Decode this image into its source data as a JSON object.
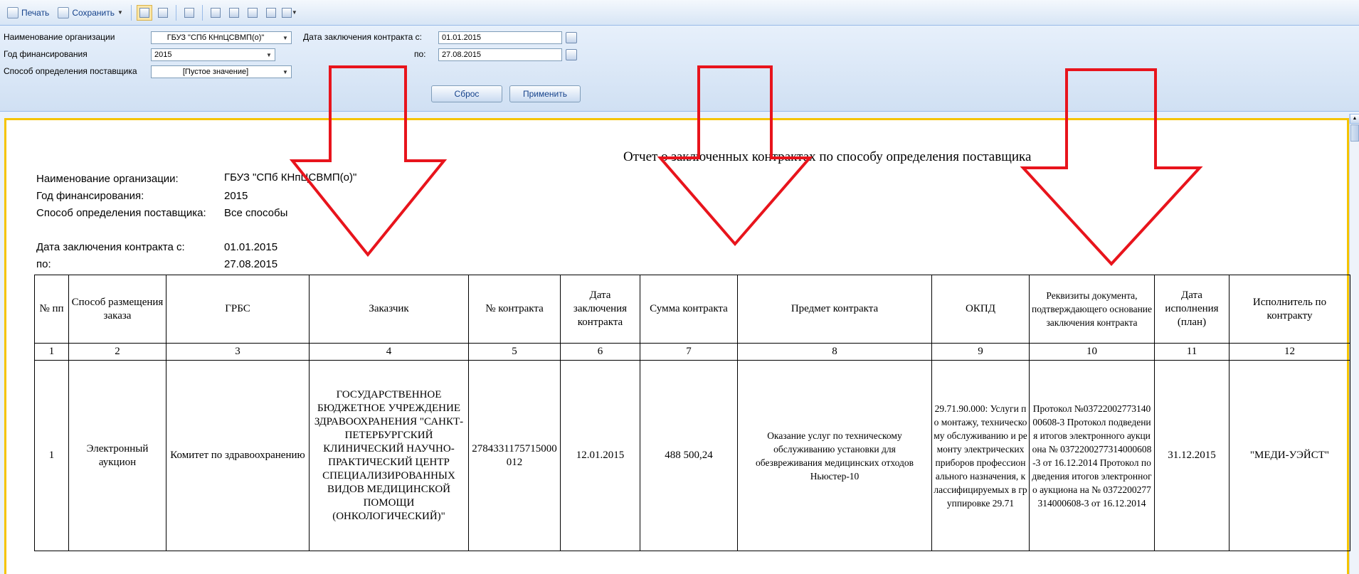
{
  "toolbar": {
    "print_label": "Печать",
    "save_label": "Сохранить"
  },
  "filters": {
    "org_label": "Наименование организации",
    "org_value": "ГБУЗ \"СПб КНпЦСВМП(о)\"",
    "year_label": "Год финансирования",
    "year_value": "2015",
    "method_label": "Способ определения поставщика",
    "method_value": "[Пустое значение]",
    "date_from_label": "Дата заключения контракта с:",
    "date_from_value": "01.01.2015",
    "date_to_label": "по:",
    "date_to_value": "27.08.2015",
    "reset_label": "Сброс",
    "apply_label": "Применить"
  },
  "report": {
    "title": "Отчет о заключенных контрактах по способу определения поставщика",
    "info": [
      {
        "label": "Наименование организации:",
        "value": "ГБУЗ \"СПб КНпЦСВМП(о)\""
      },
      {
        "label": "Год финансирования:",
        "value": "2015"
      },
      {
        "label": "Способ определения поставщика:",
        "value": "Все способы"
      },
      {
        "label": "Дата заключения контракта с:",
        "value": "01.01.2015"
      },
      {
        "label": "по:",
        "value": "27.08.2015"
      }
    ],
    "columns": [
      "№ пп",
      "Способ размещения заказа",
      "ГРБС",
      "Заказчик",
      "№ контракта",
      "Дата заключения контракта",
      "Сумма контракта",
      "Предмет контракта",
      "ОКПД",
      "Реквизиты документа, подтверждающего основание заключения контракта",
      "Дата исполнения (план)",
      "Исполнитель по контракту"
    ],
    "column_numbers": [
      "1",
      "2",
      "3",
      "4",
      "5",
      "6",
      "7",
      "8",
      "9",
      "10",
      "11",
      "12"
    ],
    "rows": [
      {
        "n": "1",
        "method": "Электронный аукцион",
        "grbs": "Комитет по здравоохранению",
        "customer": "ГОСУДАРСТВЕННОЕ БЮДЖЕТНОЕ УЧРЕЖДЕНИЕ ЗДРАВООХРАНЕНИЯ \"САНКТ-ПЕТЕРБУРГСКИЙ КЛИНИЧЕСКИЙ НАУЧНО-ПРАКТИЧЕСКИЙ ЦЕНТР СПЕЦИАЛИЗИРОВАННЫХ ВИДОВ МЕДИЦИНСКОЙ ПОМОЩИ (ОНКОЛОГИЧЕСКИЙ)\"",
        "contract_no": "2784331175715000012",
        "date": "12.01.2015",
        "sum": "488 500,24",
        "subject": "Оказание услуг по техническому обслуживанию установки для обезвреживания медицинских отходов Ньюстер-10",
        "okpd": "29.71.90.000: Услуги по монтажу, техническому обслуживанию и ремонту электрических приборов профессионального назначения, классифицируемых в группировке 29.71",
        "docs": "Протокол №0372200277314000608-3 Протокол подведения итогов электронного аукциона № 0372200277314000608-3 от 16.12.2014 Протокол подведения итогов электронного аукциона на № 0372200277314000608-3 от 16.12.2014",
        "exec_date": "31.12.2015",
        "executor": "\"МЕДИ-УЭЙСТ\""
      }
    ]
  },
  "colors": {
    "annotation_arrow": "#e8141c",
    "report_border": "#f5c400",
    "panel_bg": "#d6e4f5"
  }
}
